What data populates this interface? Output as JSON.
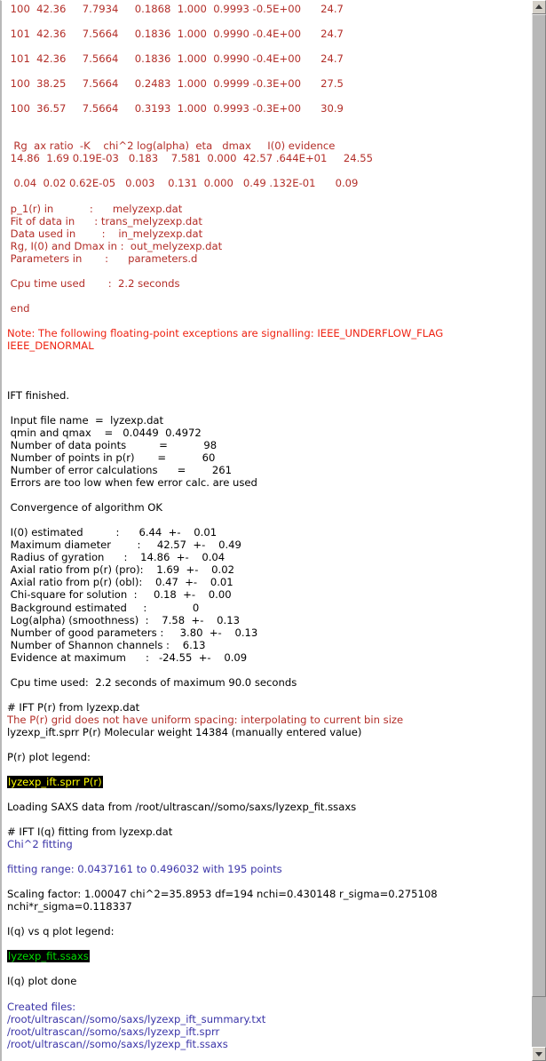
{
  "window": {
    "title": "IFT console output",
    "colors": {
      "text_black": "#000000",
      "text_brick_red": "#b32e28",
      "text_bright_red": "#ee2211",
      "text_blue": "#3b35a8",
      "highlight_background": "#000000",
      "highlight_yellow": "#ffff00",
      "highlight_green": "#00dd00",
      "scrollbar_track": "#b4b4b4",
      "scrollbar_thumb": "#b8b8b8",
      "pane_background": "#ffffff"
    }
  },
  "scrollbar": {
    "up_arrow": "scroll-up-arrow",
    "down_arrow": "scroll-down-arrow"
  },
  "log_lines": [
    {
      "id": "iter-row-1",
      "color": "brick",
      "text": " 100  42.36     7.7934     0.1868  1.000  0.9993 -0.5E+00      24.7"
    },
    {
      "id": "spacer-1",
      "color": "black",
      "text": ""
    },
    {
      "id": "iter-row-2",
      "color": "brick",
      "text": " 101  42.36     7.5664     0.1836  1.000  0.9990 -0.4E+00      24.7"
    },
    {
      "id": "spacer-2",
      "color": "black",
      "text": ""
    },
    {
      "id": "iter-row-3",
      "color": "brick",
      "text": " 101  42.36     7.5664     0.1836  1.000  0.9990 -0.4E+00      24.7"
    },
    {
      "id": "spacer-3",
      "color": "black",
      "text": ""
    },
    {
      "id": "iter-row-4",
      "color": "brick",
      "text": " 100  38.25     7.5664     0.2483  1.000  0.9999 -0.3E+00      27.5"
    },
    {
      "id": "spacer-4",
      "color": "black",
      "text": ""
    },
    {
      "id": "iter-row-5",
      "color": "brick",
      "text": " 100  36.57     7.5664     0.3193  1.000  0.9993 -0.3E+00      30.9"
    },
    {
      "id": "spacer-5",
      "color": "black",
      "text": ""
    },
    {
      "id": "spacer-6",
      "color": "black",
      "text": ""
    },
    {
      "id": "summary-header",
      "color": "brick",
      "text": "  Rg  ax ratio  -K    chi^2 log(alpha)  eta   dmax     I(0) evidence"
    },
    {
      "id": "summary-values",
      "color": "brick",
      "text": " 14.86  1.69 0.19E-03   0.183    7.581  0.000  42.57 .644E+01     24.55"
    },
    {
      "id": "spacer-7",
      "color": "black",
      "text": ""
    },
    {
      "id": "summary-errors",
      "color": "brick",
      "text": "  0.04  0.02 0.62E-05   0.003    0.131  0.000   0.49 .132E-01      0.09"
    },
    {
      "id": "spacer-8",
      "color": "black",
      "text": ""
    },
    {
      "id": "file-p1r",
      "color": "brick",
      "text": " p_1(r) in           :      melyzexp.dat"
    },
    {
      "id": "file-fit",
      "color": "brick",
      "text": " Fit of data in      : trans_melyzexp.dat"
    },
    {
      "id": "file-data",
      "color": "brick",
      "text": " Data used in        :    in_melyzexp.dat"
    },
    {
      "id": "file-out",
      "color": "brick",
      "text": " Rg, I(0) and Dmax in :  out_melyzexp.dat"
    },
    {
      "id": "file-params",
      "color": "brick",
      "text": " Parameters in       :      parameters.d"
    },
    {
      "id": "spacer-9",
      "color": "black",
      "text": ""
    },
    {
      "id": "cpu-time-1",
      "color": "brick",
      "text": " Cpu time used       :  2.2 seconds"
    },
    {
      "id": "spacer-10",
      "color": "black",
      "text": ""
    },
    {
      "id": "end-marker",
      "color": "brick",
      "text": " end"
    },
    {
      "id": "spacer-11",
      "color": "black",
      "text": ""
    },
    {
      "id": "fp-note-1",
      "color": "red",
      "text": "Note: The following floating-point exceptions are signalling: IEEE_UNDERFLOW_FLAG"
    },
    {
      "id": "fp-note-2",
      "color": "red",
      "text": "IEEE_DENORMAL"
    },
    {
      "id": "spacer-12",
      "color": "black",
      "text": ""
    },
    {
      "id": "spacer-13",
      "color": "black",
      "text": ""
    },
    {
      "id": "spacer-14",
      "color": "black",
      "text": ""
    },
    {
      "id": "ift-finished",
      "color": "black",
      "text": "IFT finished."
    },
    {
      "id": "spacer-15",
      "color": "black",
      "text": ""
    },
    {
      "id": "input-file",
      "color": "black",
      "text": " Input file name  =  lyzexp.dat"
    },
    {
      "id": "qmin-qmax",
      "color": "black",
      "text": " qmin and qmax    =   0.0449  0.4972"
    },
    {
      "id": "n-data",
      "color": "black",
      "text": " Number of data points          =           98"
    },
    {
      "id": "n-pr",
      "color": "black",
      "text": " Number of points in p(r)       =           60"
    },
    {
      "id": "n-errcalc",
      "color": "black",
      "text": " Number of error calculations      =        261"
    },
    {
      "id": "err-warning",
      "color": "black",
      "text": " Errors are too low when few error calc. are used"
    },
    {
      "id": "spacer-16",
      "color": "black",
      "text": ""
    },
    {
      "id": "convergence",
      "color": "black",
      "text": " Convergence of algorithm OK"
    },
    {
      "id": "spacer-17",
      "color": "black",
      "text": ""
    },
    {
      "id": "res-i0",
      "color": "black",
      "text": " I(0) estimated          :      6.44  +-    0.01"
    },
    {
      "id": "res-dmax",
      "color": "black",
      "text": " Maximum diameter        :     42.57  +-    0.49"
    },
    {
      "id": "res-rg",
      "color": "black",
      "text": " Radius of gyration      :    14.86  +-    0.04"
    },
    {
      "id": "res-ax-pro",
      "color": "black",
      "text": " Axial ratio from p(r) (pro):    1.69  +-    0.02"
    },
    {
      "id": "res-ax-obl",
      "color": "black",
      "text": " Axial ratio from p(r) (obl):    0.47  +-    0.01"
    },
    {
      "id": "res-chisq",
      "color": "black",
      "text": " Chi-square for solution  :     0.18  +-    0.00"
    },
    {
      "id": "res-bkgd",
      "color": "black",
      "text": " Background estimated     :              0"
    },
    {
      "id": "res-logalpha",
      "color": "black",
      "text": " Log(alpha) (smoothness)  :    7.58  +-    0.13"
    },
    {
      "id": "res-ngood",
      "color": "black",
      "text": " Number of good parameters :     3.80  +-    0.13"
    },
    {
      "id": "res-shannon",
      "color": "black",
      "text": " Number of Shannon channels :    6.13"
    },
    {
      "id": "res-evidence",
      "color": "black",
      "text": " Evidence at maximum      :   -24.55  +-    0.09"
    },
    {
      "id": "spacer-18",
      "color": "black",
      "text": ""
    },
    {
      "id": "cpu-time-2",
      "color": "black",
      "text": " Cpu time used:  2.2 seconds of maximum 90.0 seconds"
    },
    {
      "id": "spacer-19",
      "color": "black",
      "text": ""
    },
    {
      "id": "ift-pr-hdr",
      "color": "black",
      "text": "# IFT P(r) from lyzexp.dat"
    },
    {
      "id": "grid-warning",
      "color": "brick",
      "text": "The P(r) grid does not have uniform spacing: interpolating to current bin size"
    },
    {
      "id": "mw-line",
      "color": "black",
      "text": "lyzexp_ift.sprr P(r) Molecular weight 14384 (manually entered value)"
    },
    {
      "id": "spacer-20",
      "color": "black",
      "text": ""
    },
    {
      "id": "pr-legend-hdr",
      "color": "black",
      "text": "P(r) plot legend:"
    },
    {
      "id": "spacer-21",
      "color": "black",
      "text": ""
    },
    {
      "id": "pr-legend-entry",
      "color": "hl-yellow",
      "text": "lyzexp_ift.sprr P(r)"
    },
    {
      "id": "spacer-22",
      "color": "black",
      "text": ""
    },
    {
      "id": "loading-saxs",
      "color": "black",
      "text": "Loading SAXS data from /root/ultrascan//somo/saxs/lyzexp_fit.ssaxs"
    },
    {
      "id": "spacer-23",
      "color": "black",
      "text": ""
    },
    {
      "id": "ift-iq-hdr",
      "color": "black",
      "text": "# IFT I(q) fitting from lyzexp.dat"
    },
    {
      "id": "chi2-fitting",
      "color": "blue",
      "text": "Chi^2 fitting"
    },
    {
      "id": "spacer-24",
      "color": "black",
      "text": ""
    },
    {
      "id": "fitting-range",
      "color": "blue",
      "text": "fitting range: 0.0437161 to 0.496032 with 195 points"
    },
    {
      "id": "spacer-25",
      "color": "black",
      "text": ""
    },
    {
      "id": "scaling-line-1",
      "color": "black",
      "text": "Scaling factor: 1.00047 chi^2=35.8953 df=194 nchi=0.430148 r_sigma=0.275108"
    },
    {
      "id": "scaling-line-2",
      "color": "black",
      "text": "nchi*r_sigma=0.118337"
    },
    {
      "id": "spacer-26",
      "color": "black",
      "text": ""
    },
    {
      "id": "iq-legend-hdr",
      "color": "black",
      "text": "I(q) vs q plot legend:"
    },
    {
      "id": "spacer-27",
      "color": "black",
      "text": ""
    },
    {
      "id": "iq-legend-entry",
      "color": "hl-green",
      "text": "lyzexp_fit.ssaxs"
    },
    {
      "id": "spacer-28",
      "color": "black",
      "text": ""
    },
    {
      "id": "iq-plot-done",
      "color": "black",
      "text": "I(q) plot done"
    },
    {
      "id": "spacer-29",
      "color": "black",
      "text": ""
    },
    {
      "id": "created-files-hdr",
      "color": "blue",
      "text": "Created files:"
    },
    {
      "id": "created-file-1",
      "color": "blue",
      "text": "/root/ultrascan//somo/saxs/lyzexp_ift_summary.txt"
    },
    {
      "id": "created-file-2",
      "color": "blue",
      "text": "/root/ultrascan//somo/saxs/lyzexp_ift.sprr"
    },
    {
      "id": "created-file-3",
      "color": "blue",
      "text": "/root/ultrascan//somo/saxs/lyzexp_fit.ssaxs"
    },
    {
      "id": "spacer-30",
      "color": "black",
      "text": ""
    }
  ],
  "results": {
    "input_file_name": "lyzexp.dat",
    "qmin": "0.0449",
    "qmax": "0.4972",
    "number_of_data_points": "98",
    "number_of_points_in_pr": "60",
    "number_of_error_calculations": "261",
    "convergence": "Convergence of algorithm OK",
    "i0_estimated": "6.44",
    "i0_error": "0.01",
    "maximum_diameter": "42.57",
    "maximum_diameter_error": "0.49",
    "radius_of_gyration": "14.86",
    "radius_of_gyration_error": "0.04",
    "axial_ratio_prolate": "1.69",
    "axial_ratio_prolate_error": "0.02",
    "axial_ratio_oblate": "0.47",
    "axial_ratio_oblate_error": "0.01",
    "chi_square_for_solution": "0.18",
    "chi_square_error": "0.00",
    "background_estimated": "0",
    "log_alpha_smoothness": "7.58",
    "log_alpha_error": "0.13",
    "number_of_good_parameters": "3.80",
    "number_of_good_parameters_error": "0.13",
    "number_of_shannon_channels": "6.13",
    "evidence_at_maximum": "-24.55",
    "evidence_at_maximum_error": "0.09",
    "cpu_time_used": "2.2 seconds",
    "cpu_time_max": "90.0 seconds",
    "molecular_weight": "14384",
    "scaling_factor": "1.00047",
    "chi_squared": "35.8953",
    "df": "194",
    "nchi": "0.430148",
    "r_sigma": "0.275108",
    "nchi_times_r_sigma": "0.118337",
    "fitting_range_start": "0.0437161",
    "fitting_range_end": "0.496032",
    "fitting_points": "195"
  }
}
